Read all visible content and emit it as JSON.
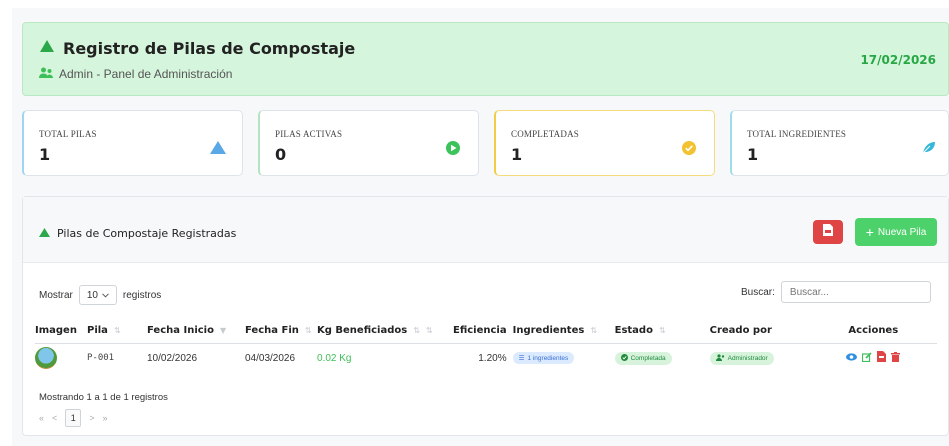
{
  "header": {
    "title": "Registro de Pilas de Compostaje",
    "subtitle": "Admin - Panel de Administración",
    "date": "17/02/2026"
  },
  "stats": [
    {
      "label": "TOTAL PILAS",
      "value": "1",
      "icon": "triangle-icon",
      "color": "#5aa8e6"
    },
    {
      "label": "PILAS ACTIVAS",
      "value": "0",
      "icon": "play-icon",
      "color": "#3cc35c"
    },
    {
      "label": "COMPLETADAS",
      "value": "1",
      "icon": "check-circle-icon",
      "color": "#f2c230"
    },
    {
      "label": "TOTAL INGREDIENTES",
      "value": "1",
      "icon": "leaf-icon",
      "color": "#36b8d8"
    }
  ],
  "panel": {
    "title": "Pilas de Compostaje Registradas",
    "new_button": "Nueva Pila"
  },
  "controls": {
    "show_label": "Mostrar",
    "page_size": "10",
    "records_label": "registros",
    "search_label": "Buscar:",
    "search_placeholder": "Buscar..."
  },
  "table": {
    "headers": [
      "Imagen",
      "Pila",
      "Fecha Inicio",
      "Fecha Fin",
      "Kg Beneficiados",
      "Eficiencia",
      "Ingredientes",
      "Estado",
      "Creado por",
      "Acciones"
    ],
    "rows": [
      {
        "pila": "P-001",
        "fecha_inicio": "10/02/2026",
        "fecha_fin": "04/03/2026",
        "kg": "0.02 Kg",
        "eficiencia": "1.20%",
        "ingredientes": "1 ingredientes",
        "estado": "Completada",
        "creado_por": "Administrador"
      }
    ]
  },
  "footer": {
    "info": "Mostrando 1 a 1 de 1 registros",
    "first": "«",
    "prev": "<",
    "page": "1",
    "next": ">",
    "last": "»"
  },
  "colors": {
    "accent_green": "#4dd16a",
    "header_bg": "#d6f5dd",
    "pdf_red": "#e04545"
  }
}
